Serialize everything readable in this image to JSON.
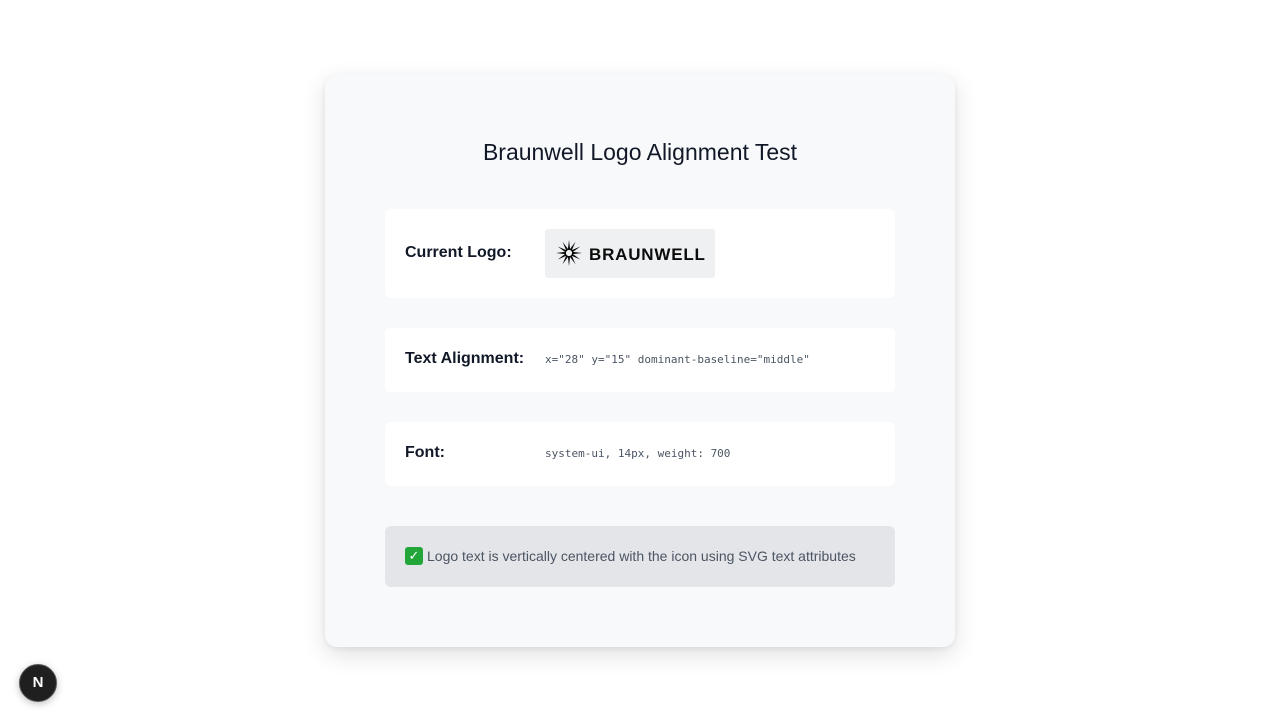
{
  "page": {
    "title": "Braunwell Logo Alignment Test"
  },
  "logo_row": {
    "label": "Current Logo:",
    "logo_text": "BRAUNWELL"
  },
  "alignment_row": {
    "label": "Text Alignment:",
    "value": "x=\"28\" y=\"15\" dominant-baseline=\"middle\""
  },
  "font_row": {
    "label": "Font:",
    "value": "system-ui, 14px, weight: 700"
  },
  "status": {
    "icon": "check-mark-icon",
    "check_glyph": "✓",
    "text": "Logo text is vertically centered with the icon using SVG text attributes",
    "color": "#22a63a"
  },
  "dev_badge": {
    "icon": "nextjs-icon",
    "glyph": "N"
  }
}
